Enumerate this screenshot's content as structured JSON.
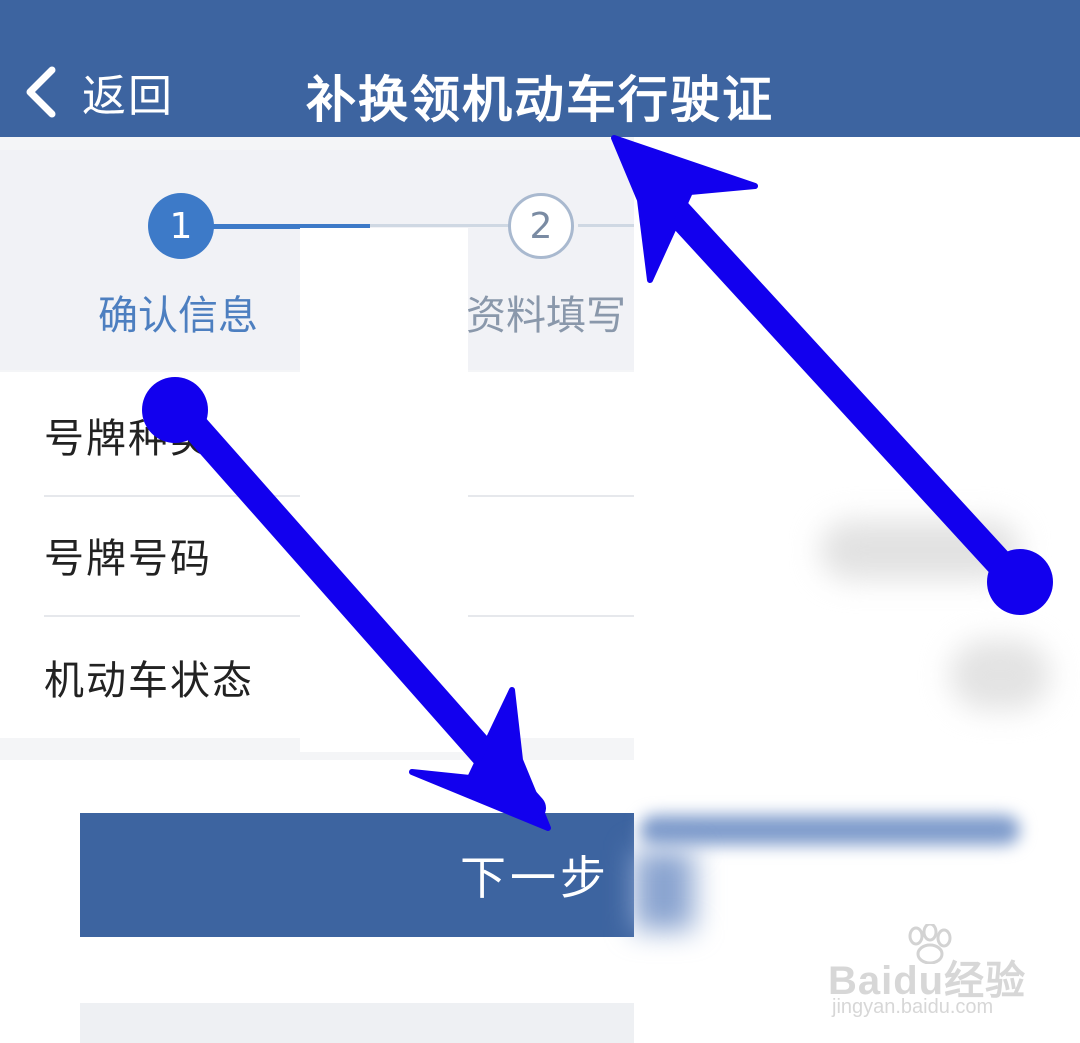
{
  "nav": {
    "back_label": "返回",
    "title": "补换领机动车行驶证"
  },
  "steps": [
    {
      "number": "1",
      "label": "确认信息",
      "state": "active"
    },
    {
      "number": "2",
      "label": "资料填写",
      "state": "inactive"
    }
  ],
  "form_rows": [
    {
      "label": "号牌种类"
    },
    {
      "label": "号牌号码"
    },
    {
      "label": "机动车状态"
    }
  ],
  "actions": {
    "next_label": "下一步"
  },
  "watermark": {
    "brand": "Baidu经验",
    "url": "jingyan.baidu.com"
  },
  "colors": {
    "header": "#3d64a0",
    "accent": "#3d7ac8",
    "annotation_arrow": "#1200ee"
  },
  "annotations": [
    {
      "type": "arrow",
      "description": "double-headed arrow from 号牌种类 row to 下一步 button"
    },
    {
      "type": "arrow",
      "description": "double-headed arrow from right side to page title"
    }
  ]
}
